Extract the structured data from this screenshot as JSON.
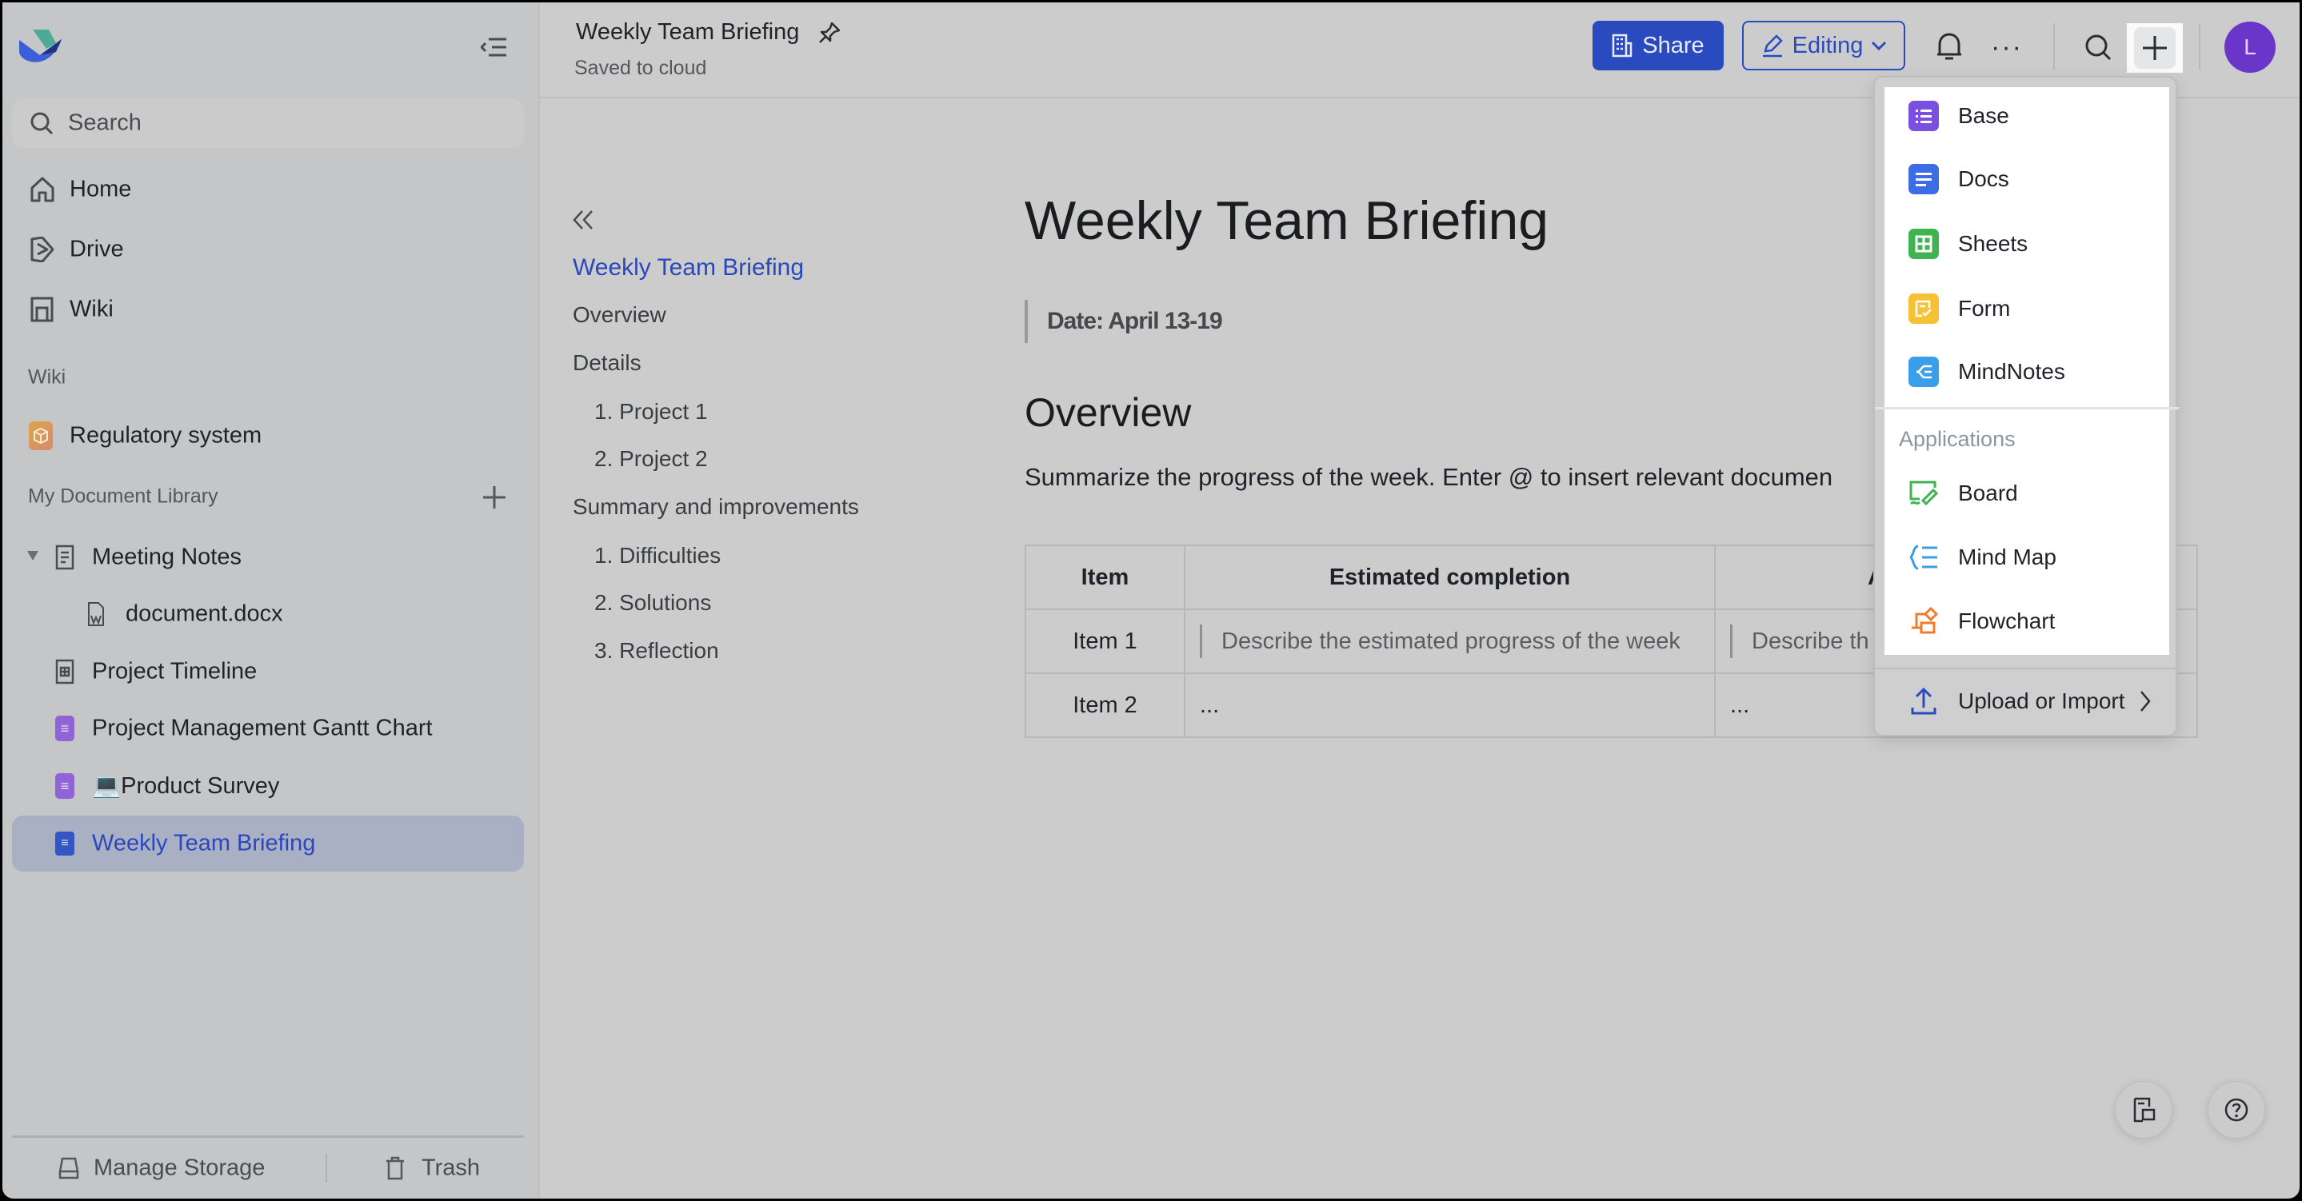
{
  "sidebar": {
    "search_placeholder": "Search",
    "nav": [
      {
        "label": "Home",
        "icon": "home-icon"
      },
      {
        "label": "Drive",
        "icon": "drive-icon"
      },
      {
        "label": "Wiki",
        "icon": "wiki-icon"
      }
    ],
    "wiki_section": "Wiki",
    "wiki_items": [
      {
        "label": "Regulatory system",
        "icon": "cube-icon"
      }
    ],
    "library_section": "My Document Library",
    "library_items": [
      {
        "label": "Meeting Notes",
        "icon": "doc-outline-icon",
        "expanded": true
      },
      {
        "label": "document.docx",
        "icon": "word-file-icon"
      },
      {
        "label": "Project Timeline",
        "icon": "sheet-outline-icon"
      },
      {
        "label": "Project Management Gantt Chart",
        "icon": "base-icon"
      },
      {
        "label": "💻Product Survey",
        "icon": "base-icon"
      },
      {
        "label": "Weekly Team Briefing",
        "icon": "docs-icon",
        "selected": true
      }
    ],
    "manage_storage": "Manage Storage",
    "trash": "Trash"
  },
  "header": {
    "title": "Weekly Team Briefing",
    "status": "Saved to cloud",
    "share_label": "Share",
    "editing_label": "Editing",
    "avatar_initial": "L"
  },
  "toc": {
    "items": [
      {
        "label": "Weekly Team Briefing",
        "level": 0,
        "active": true
      },
      {
        "label": "Overview",
        "level": 0
      },
      {
        "label": "Details",
        "level": 0
      },
      {
        "label": "1. Project 1",
        "level": 1
      },
      {
        "label": "2. Project 2",
        "level": 1
      },
      {
        "label": "Summary and improvements",
        "level": 0
      },
      {
        "label": "1. Difficulties",
        "level": 1
      },
      {
        "label": "2. Solutions",
        "level": 1
      },
      {
        "label": "3. Reflection",
        "level": 1
      }
    ]
  },
  "doc": {
    "title": "Weekly Team Briefing",
    "date": "Date: April 13-19",
    "overview_heading": "Overview",
    "overview_text": "Summarize the progress of the week. Enter @ to insert relevant documen",
    "table": {
      "headers": [
        "Item",
        "Estimated completion",
        "A"
      ],
      "rows": [
        [
          "Item 1",
          "Describe the estimated progress of the week",
          "Describe th"
        ],
        [
          "Item 2",
          "...",
          "..."
        ]
      ]
    }
  },
  "new_menu": {
    "items": [
      {
        "label": "Base",
        "icon": "base-icon",
        "color": "#7b4fe0"
      },
      {
        "label": "Docs",
        "icon": "docs-icon",
        "color": "#3c6ce6"
      },
      {
        "label": "Sheets",
        "icon": "sheets-icon",
        "color": "#3fb34f"
      },
      {
        "label": "Form",
        "icon": "form-icon",
        "color": "#f6c233"
      },
      {
        "label": "MindNotes",
        "icon": "mindnotes-icon",
        "color": "#3a9fe8"
      }
    ],
    "applications_label": "Applications",
    "applications": [
      {
        "label": "Board",
        "icon": "board-icon",
        "color": "#3fb34f"
      },
      {
        "label": "Mind Map",
        "icon": "mind-map-icon",
        "color": "#3a9fe8"
      },
      {
        "label": "Flowchart",
        "icon": "flowchart-icon",
        "color": "#f07c2a"
      }
    ],
    "upload_label": "Upload or Import"
  },
  "colors": {
    "accent": "#2a4bbf",
    "avatar": "#6a35c9"
  }
}
